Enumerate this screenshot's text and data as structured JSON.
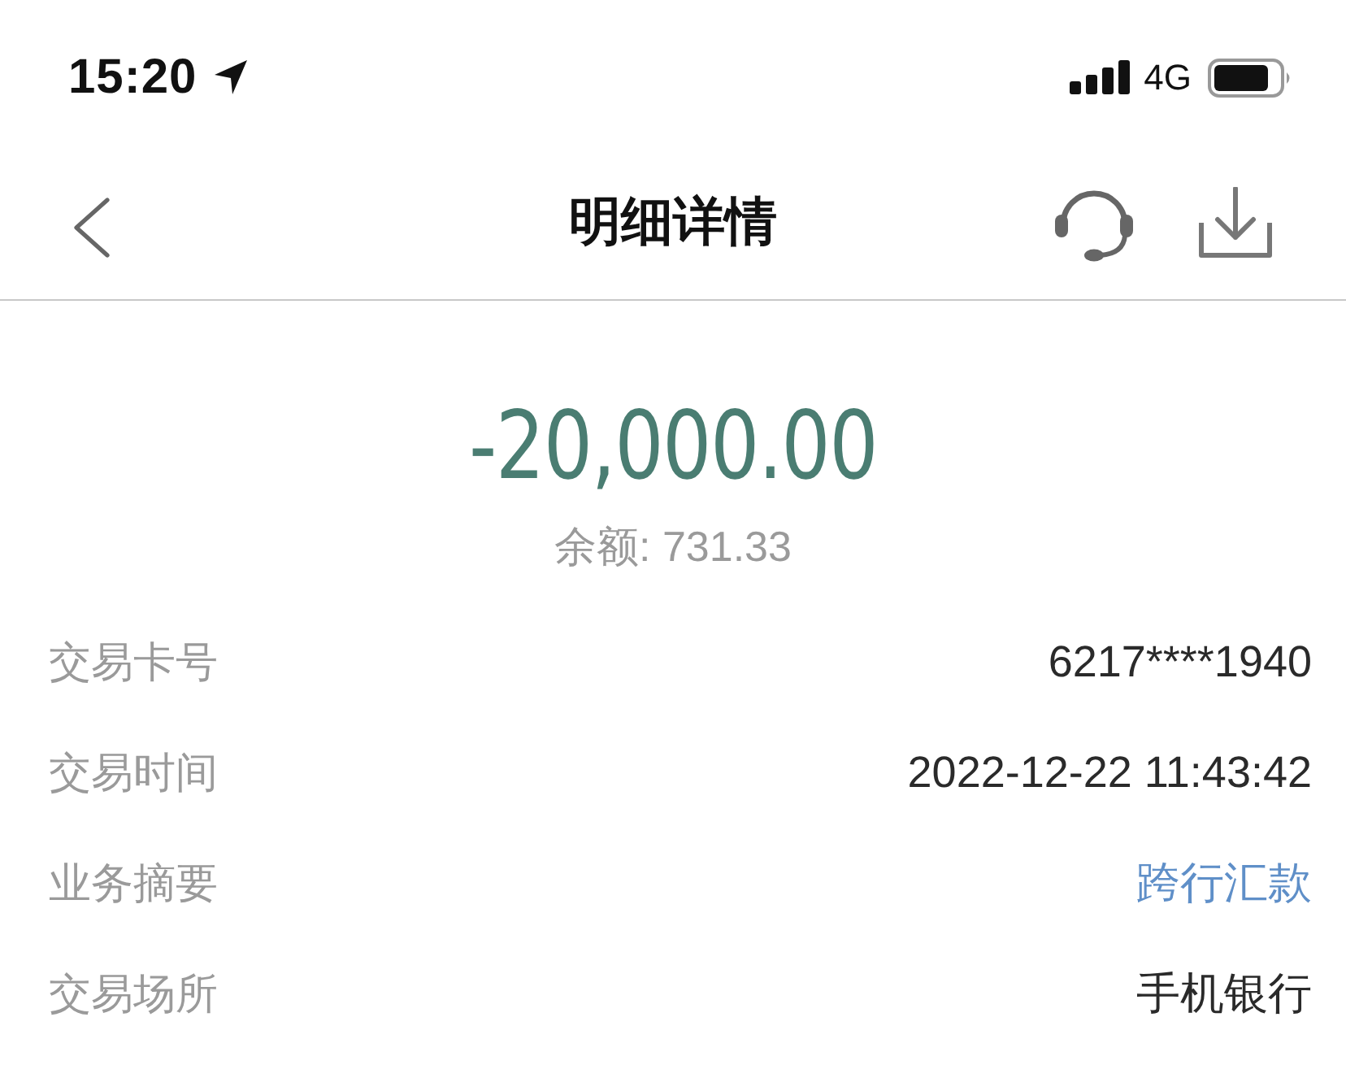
{
  "status_bar": {
    "time": "15:20",
    "network": "4G"
  },
  "nav": {
    "title": "明细详情"
  },
  "summary": {
    "amount": "-20,000.00",
    "balance": "余额: 731.33"
  },
  "details": [
    {
      "label": "交易卡号",
      "value": "6217****1940",
      "kind": "text"
    },
    {
      "label": "交易时间",
      "value": "2022-12-22 11:43:42",
      "kind": "text"
    },
    {
      "label": "业务摘要",
      "value": "跨行汇款",
      "kind": "link"
    },
    {
      "label": "交易场所",
      "value": "手机银行",
      "kind": "text"
    }
  ]
}
